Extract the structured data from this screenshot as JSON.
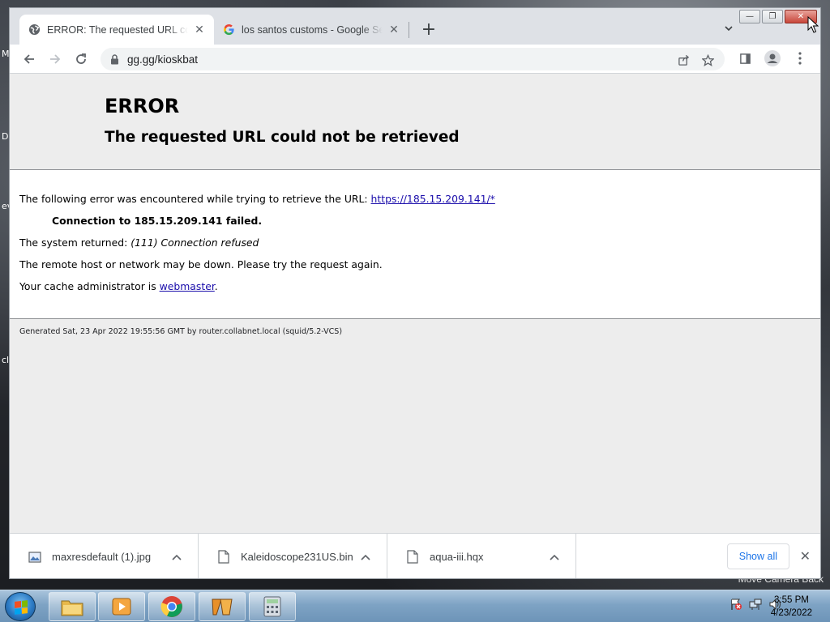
{
  "desktop": {
    "left_letters": [
      "M",
      "D",
      "ev",
      "cl"
    ],
    "overlay_text": "Move Camera   Back"
  },
  "window_controls": {
    "minimize": "—",
    "restore": "❐",
    "close": "✕"
  },
  "tabs": [
    {
      "title": "ERROR: The requested URL could not be retrieved",
      "favicon": "globe-icon",
      "active": true
    },
    {
      "title": "los santos customs - Google Search",
      "favicon": "google-g-icon",
      "active": false
    }
  ],
  "tab_list_icon": "chevron-down-icon",
  "address_bar": {
    "url": "gg.gg/kioskbat"
  },
  "page": {
    "title": "ERROR",
    "subtitle": "The requested URL could not be retrieved",
    "line1_prefix": "The following error was encountered while trying to retrieve the URL: ",
    "line1_link": "https://185.15.209.141/*",
    "connection_failed": "Connection to 185.15.209.141 failed.",
    "system_prefix": "The system returned: ",
    "system_error": "(111) Connection refused",
    "remote_down": "The remote host or network may be down. Please try the request again.",
    "admin_prefix": "Your cache administrator is ",
    "admin_link": "webmaster",
    "admin_suffix": ".",
    "generated": "Generated Sat, 23 Apr 2022 19:55:56 GMT by router.collabnet.local (squid/5.2-VCS)"
  },
  "downloads": {
    "items": [
      {
        "name": "maxresdefault (1).jpg",
        "icon": "image-file-icon"
      },
      {
        "name": "Kaleidoscope231US.bin",
        "icon": "file-icon"
      },
      {
        "name": "aqua-iii.hqx",
        "icon": "file-icon"
      }
    ],
    "show_all": "Show all"
  },
  "taskbar": {
    "apps": [
      "explorer",
      "media-player",
      "chrome",
      "unknown-app",
      "calculator"
    ],
    "time": "3:55 PM",
    "date": "4/23/2022"
  }
}
